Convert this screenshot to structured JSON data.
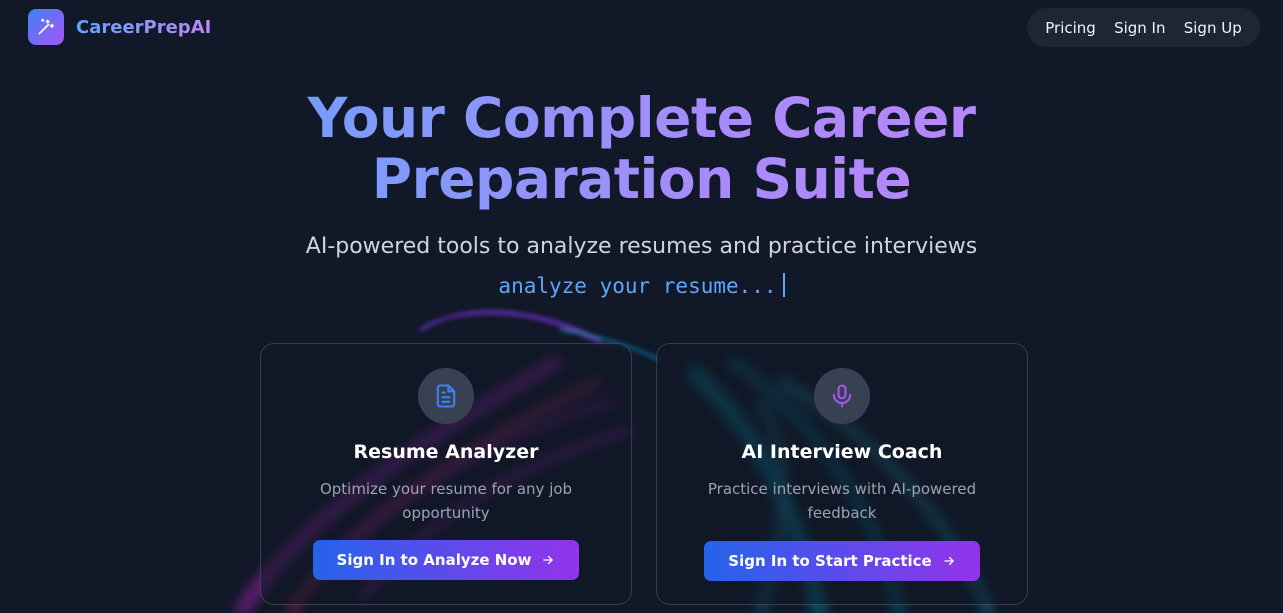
{
  "brand": {
    "name": "CareerPrepAI",
    "icon": "magic-wand-icon"
  },
  "nav": {
    "pricing": "Pricing",
    "sign_in": "Sign In",
    "sign_up": "Sign Up"
  },
  "hero": {
    "title_line1": "Your Complete Career",
    "title_line2": "Preparation Suite",
    "subtitle": "AI-powered tools to analyze resumes and practice interviews",
    "typing_text": "analyze your resume..."
  },
  "cards": [
    {
      "icon": "document-icon",
      "title": "Resume Analyzer",
      "description": "Optimize your resume for any job opportunity",
      "button": "Sign In to Analyze Now"
    },
    {
      "icon": "microphone-icon",
      "title": "AI Interview Coach",
      "description": "Practice interviews with AI-powered feedback",
      "button": "Sign In to Start Practice"
    }
  ],
  "colors": {
    "background": "#111827",
    "accent_blue": "#3b82f6",
    "accent_purple": "#a855f7",
    "card_icon_bg": "#374151"
  }
}
